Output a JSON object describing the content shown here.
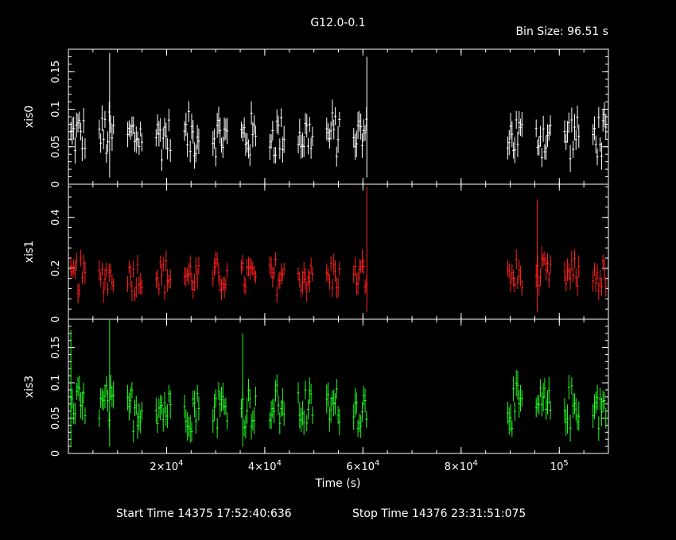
{
  "title": "G12.0-0.1",
  "bin_size": "Bin Size: 96.51 s",
  "xlabel": "Time (s)",
  "start_time": "Start Time 14375 17:52:40:636",
  "stop_time": "Stop Time 14376 23:31:51:075",
  "colors": {
    "background": "#000000",
    "axes": "#ffffff",
    "xis0": "#ffffff",
    "xis1": "#ff2020",
    "xis3": "#20ff20"
  },
  "chart_data": {
    "type": "line",
    "xlabel": "Time (s)",
    "xlim": [
      0,
      110000
    ],
    "x_ticks": [
      {
        "value": 20000,
        "base": "2×10",
        "exp": "4"
      },
      {
        "value": 40000,
        "base": "4×10",
        "exp": "4"
      },
      {
        "value": 60000,
        "base": "6×10",
        "exp": "4"
      },
      {
        "value": 80000,
        "base": "8×10",
        "exp": "4"
      },
      {
        "value": 100000,
        "base": "10",
        "exp": "5"
      }
    ],
    "observation_windows": [
      [
        500,
        61000
      ],
      [
        89500,
        109500
      ]
    ],
    "orbit_period": 5760,
    "panels": [
      {
        "name": "xis0",
        "color": "#ffffff",
        "ylim": [
          0,
          0.18
        ],
        "yticks": [
          0,
          0.05,
          0.1,
          0.15
        ],
        "ytick_labels": [
          "0",
          "0.05",
          "0.1",
          "0.15"
        ],
        "level": 0.065,
        "spread": 0.035,
        "errbar": 0.014,
        "spikes": [
          [
            8400,
            0.175
          ],
          [
            60800,
            0.17
          ]
        ]
      },
      {
        "name": "xis1",
        "color": "#ff2020",
        "ylim": [
          0,
          0.53
        ],
        "yticks": [
          0,
          0.2,
          0.4
        ],
        "ytick_labels": [
          "0",
          "0.2",
          "0.4"
        ],
        "level": 0.17,
        "spread": 0.075,
        "errbar": 0.035,
        "spikes": [
          [
            60800,
            0.52
          ],
          [
            95500,
            0.47
          ]
        ]
      },
      {
        "name": "xis3",
        "color": "#20ff20",
        "ylim": [
          0,
          0.19
        ],
        "yticks": [
          0,
          0.05,
          0.1,
          0.15
        ],
        "ytick_labels": [
          "0",
          "0.05",
          "0.1",
          "0.15"
        ],
        "level": 0.065,
        "spread": 0.035,
        "errbar": 0.016,
        "spikes": [
          [
            500,
            0.175
          ],
          [
            8400,
            0.19
          ],
          [
            35500,
            0.17
          ]
        ]
      }
    ]
  }
}
